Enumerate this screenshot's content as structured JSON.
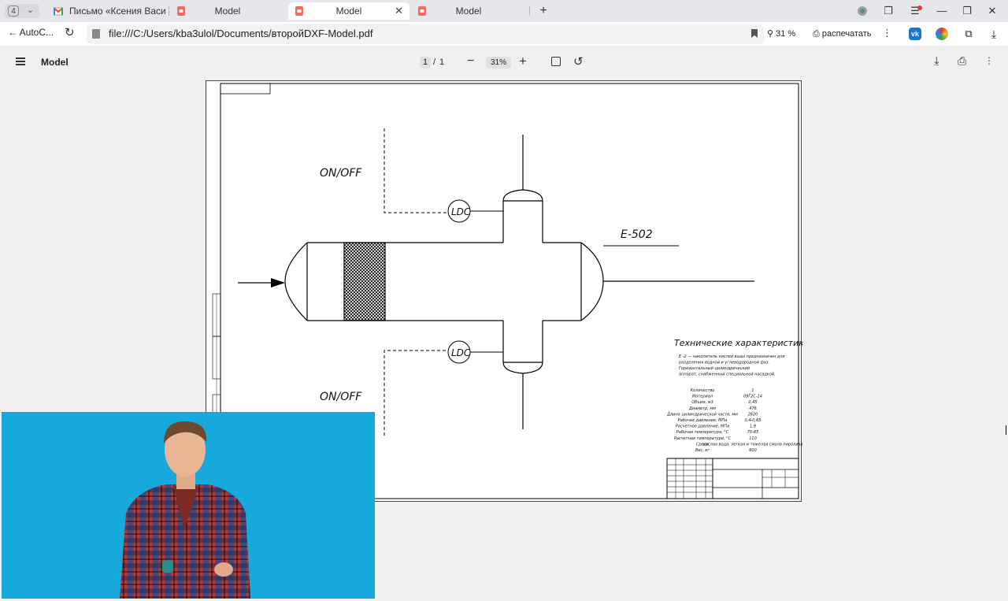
{
  "browser": {
    "tab_count": "4",
    "tabs": [
      {
        "label": "Письмо «Ксения Василье",
        "icon": "gmail-icon",
        "active": false
      },
      {
        "label": "Model",
        "icon": "pdf-icon",
        "active": false
      },
      {
        "label": "Model",
        "icon": "pdf-icon",
        "active": true
      },
      {
        "label": "Model",
        "icon": "pdf-icon",
        "active": false
      }
    ],
    "back_label": "AutoC...",
    "url": "file:///C:/Users/kba3ulol/Documents/второйDXF-Model.pdf",
    "zoom": "31 %",
    "print_label": "распечатать",
    "accent_color": "#1a73e8"
  },
  "pdf_toolbar": {
    "title": "Model",
    "current_page": "1",
    "page_separator": "/",
    "total_pages": "1",
    "zoom": "31%"
  },
  "drawing": {
    "label_onoff_top": "ON/OFF",
    "label_onoff_bottom": "ON/OFF",
    "label_ldc_top": "LDC",
    "label_ldc_bottom": "LDC",
    "equipment_tag": "E-502",
    "specs_title": "Технические характеристики",
    "description": [
      "Е -2 — накопитель кислой воды предназначен для",
      "разделения водной и углеводородной фаз.",
      "Горизонтальный цилиндрический",
      "аппарат, снабженный специальной насадкой."
    ],
    "specs": [
      {
        "name": "Количество",
        "value": "1"
      },
      {
        "name": "Материал",
        "value": "09Г2С-14"
      },
      {
        "name": "Объем, м3",
        "value": "0,45"
      },
      {
        "name": "Диаметр, мм",
        "value": "476"
      },
      {
        "name": "Длина цилиндрической части, мм",
        "value": "2820"
      },
      {
        "name": "Рабочее давление, МПа",
        "value": "0,4-0,65"
      },
      {
        "name": "Расчетное давление, МПа",
        "value": "1,9"
      },
      {
        "name": "Рабочая температура, °С",
        "value": "75-85"
      },
      {
        "name": "Расчетная температура, °С",
        "value": "110"
      },
      {
        "name": "Среда",
        "value": "кислая вода, легкая и тяжелая смола пиролиза"
      },
      {
        "name": "Вес, кг",
        "value": "600"
      }
    ]
  }
}
